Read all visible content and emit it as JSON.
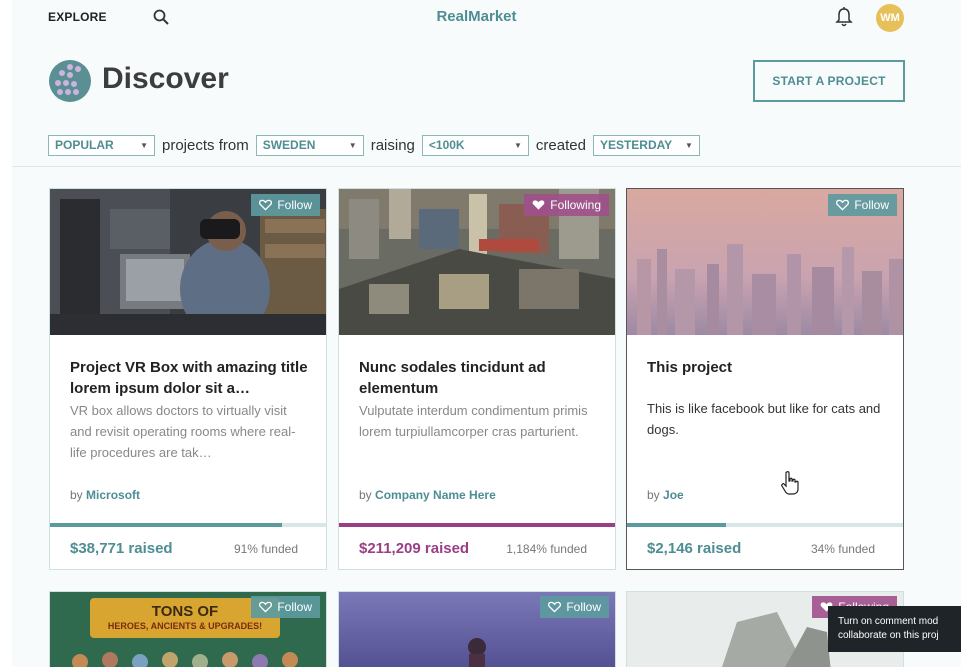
{
  "topbar": {
    "explore": "EXPLORE",
    "brand": "RealMarket",
    "avatar": "WM"
  },
  "header": {
    "title": "Discover",
    "start_button": "START A PROJECT"
  },
  "filters": {
    "sort": "POPULAR",
    "word1": "projects from",
    "country": "SWEDEN",
    "word2": "raising",
    "amount": "<100K",
    "word3": "created",
    "date": "YESTERDAY"
  },
  "cards": [
    {
      "follow": "Follow",
      "title": "Project VR Box with amazing title lorem ipsum dolor sit a…",
      "desc": "VR box allows doctors to virtually visit and revisit operating rooms where real-life procedures are tak…",
      "by_prefix": "by",
      "by": "Microsoft",
      "raised": "$38,771 raised",
      "funded": "91% funded",
      "progress": 0.84
    },
    {
      "follow": "Following",
      "title": "Nunc sodales tincidunt ad elementum",
      "desc": "Vulputate interdum condimentum primis lorem turpiullamcorper cras parturient.",
      "by_prefix": "by",
      "by": "Company Name Here",
      "raised": "$211,209 raised",
      "funded": "1,184% funded",
      "progress": 1.0
    },
    {
      "follow": "Follow",
      "title": "This project",
      "desc": "This is like facebook but like for cats and dogs.",
      "by_prefix": "by",
      "by": "Joe",
      "raised": "$2,146 raised",
      "funded": "34% funded",
      "progress": 0.36
    }
  ],
  "bottom_cards": [
    {
      "follow": "Follow",
      "banner_line1": "TONS OF",
      "banner_line2": "HEROES, ANCIENTS & UPGRADES!"
    },
    {
      "follow": "Follow"
    },
    {
      "follow": "Following"
    }
  ],
  "tooltip": {
    "line1": "Turn on comment mod",
    "line2": "collaborate on this proj"
  },
  "colors": {
    "accent": "#4e8e93",
    "pink": "#9a3f86",
    "avatar": "#e6c15a"
  }
}
